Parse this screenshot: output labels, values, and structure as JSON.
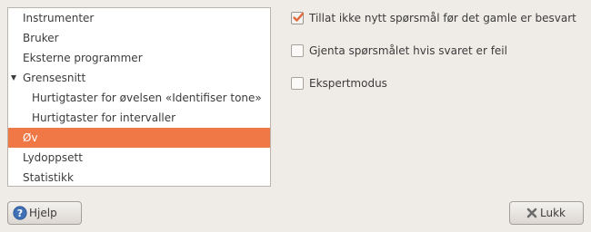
{
  "sidebar": {
    "items": [
      {
        "label": "Instrumenter"
      },
      {
        "label": "Bruker"
      },
      {
        "label": "Eksterne programmer"
      },
      {
        "label": "Grensesnitt"
      },
      {
        "label": "Hurtigtaster for øvelsen «Identifiser tone»"
      },
      {
        "label": "Hurtigtaster for intervaller"
      },
      {
        "label": "Øv"
      },
      {
        "label": "Lydoppsett"
      },
      {
        "label": "Statistikk"
      }
    ],
    "selected": "Øv"
  },
  "options": [
    {
      "label": "Tillat ikke nytt spørsmål før det gamle er besvart",
      "checked": true
    },
    {
      "label": "Gjenta spørsmålet hvis svaret er feil",
      "checked": false
    },
    {
      "label": "Ekspertmodus",
      "checked": false
    }
  ],
  "buttons": {
    "help": "Hjelp",
    "close": "Lukk"
  },
  "colors": {
    "accent": "#f07746",
    "window_bg": "#efebe7",
    "help_icon": "#3f6fb4",
    "close_icon": "#6b6b6b"
  },
  "icons": {
    "help": "help-icon",
    "close": "close-x-icon",
    "expander": "triangle-down-icon"
  }
}
